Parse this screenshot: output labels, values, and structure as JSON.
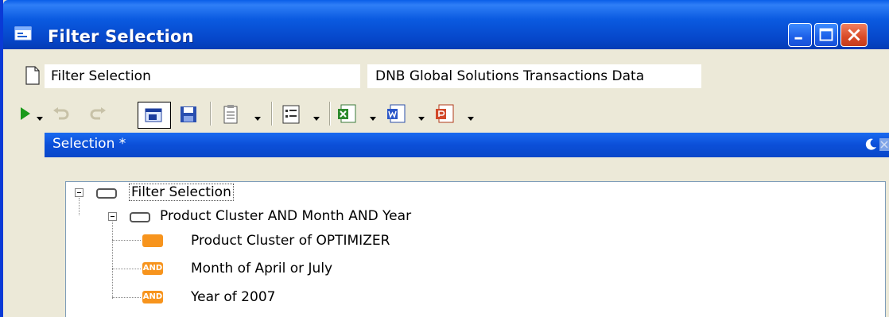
{
  "window": {
    "title": "Filter Selection",
    "accent": "#0a5ae0",
    "close_color": "#d94a26"
  },
  "namebar": {
    "name_value": "Filter Selection",
    "dataset_value": "DNB Global Solutions Transactions Data"
  },
  "toolbar": {
    "icons": [
      "run-icon",
      "undo-icon",
      "redo-icon",
      "lock-icon",
      "save-icon",
      "notes-icon",
      "list-icon",
      "excel-icon",
      "word-icon",
      "powerpoint-icon"
    ]
  },
  "panel": {
    "title": "Selection *"
  },
  "tree": {
    "root": "Filter Selection",
    "group": "Product Cluster AND Month AND Year",
    "conditions": [
      {
        "tag": "",
        "label": "Product Cluster of OPTIMIZER"
      },
      {
        "tag": "AND",
        "label": "Month of April or July"
      },
      {
        "tag": "AND",
        "label": "Year of 2007"
      }
    ],
    "tag_color": "#f7941d"
  }
}
